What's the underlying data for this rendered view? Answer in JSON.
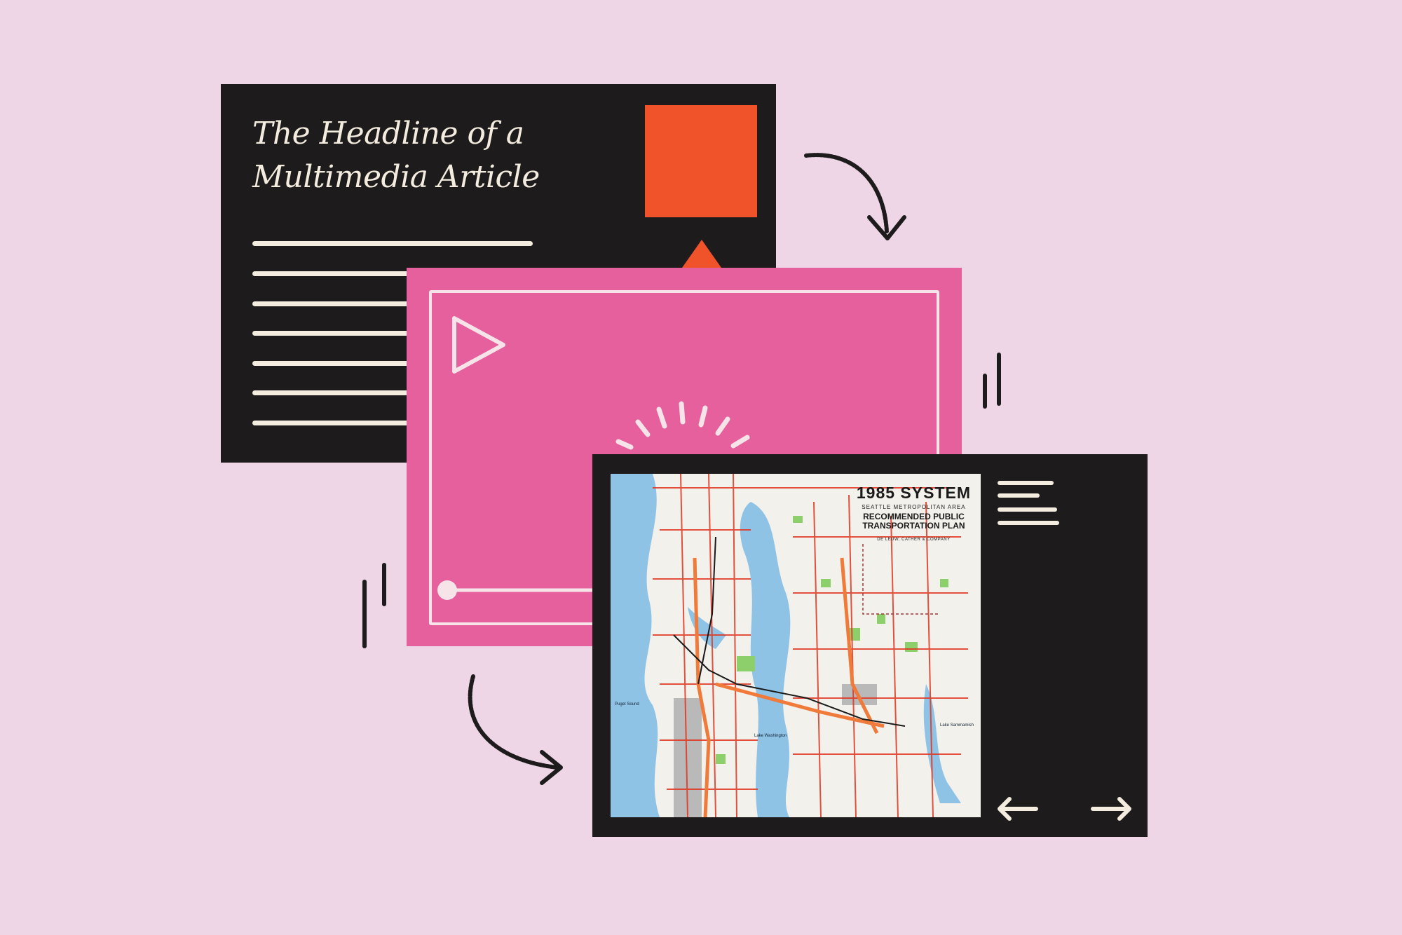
{
  "illustration": {
    "background_color": "#efd6e6",
    "article_card": {
      "headline": "The Headline of a Multimedia Article",
      "accent_color": "#f0522a",
      "card_color": "#1d1b1c"
    },
    "video_card": {
      "card_color": "#e6609e",
      "icons": [
        "play-icon",
        "loading-burst-icon",
        "progress-knob-icon"
      ]
    },
    "map_card": {
      "map": {
        "title": "1985 SYSTEM",
        "area": "SEATTLE METROPOLITAN AREA",
        "plan_line1": "RECOMMENDED PUBLIC",
        "plan_line2": "TRANSPORTATION PLAN",
        "credit": "DE LEUW, CATHER & COMPANY",
        "water_label_1": "Puget Sound",
        "water_label_2": "Lake Washington",
        "water_label_3": "Lake Sammamish"
      },
      "icons": [
        "arrow-left-icon",
        "arrow-right-icon"
      ]
    },
    "decor_icons": [
      "curved-arrow-icon",
      "motion-lines-icon"
    ]
  }
}
